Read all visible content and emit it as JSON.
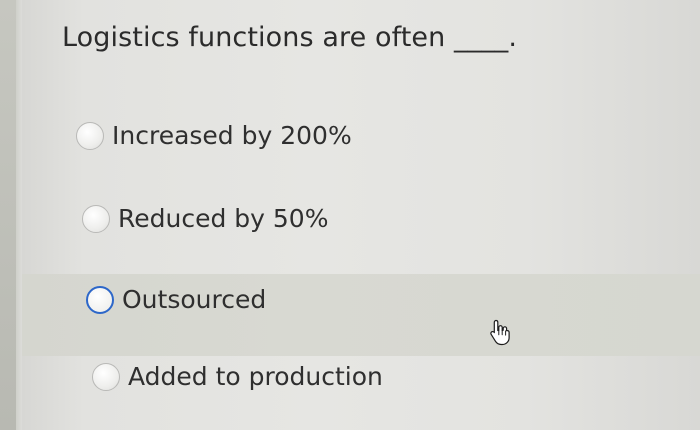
{
  "question": {
    "text": "Logistics functions are often ____."
  },
  "options": [
    {
      "label": "Increased by 200%",
      "selected": false
    },
    {
      "label": "Reduced by 50%",
      "selected": false
    },
    {
      "label": "Outsourced",
      "selected": false,
      "hovered": true
    },
    {
      "label": "Added to production",
      "selected": false
    }
  ],
  "colors": {
    "focus_ring": "#2d67c9",
    "hover_row": "#d6d7d0"
  },
  "cursor": {
    "icon": "hand-pointer-icon"
  }
}
